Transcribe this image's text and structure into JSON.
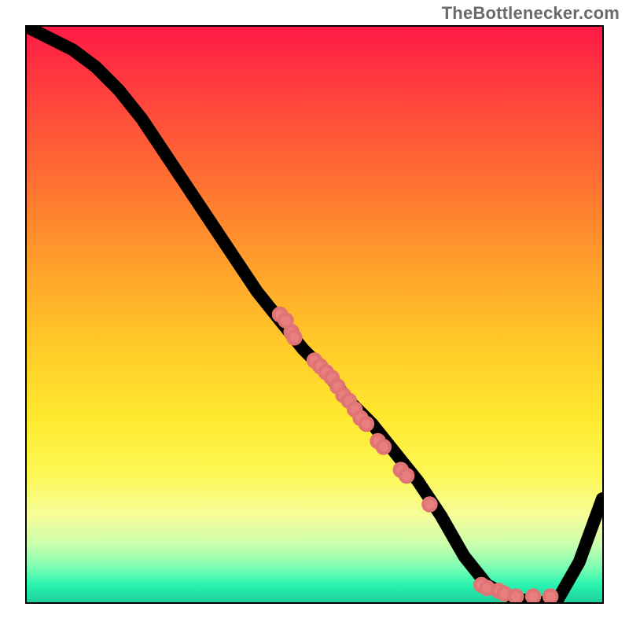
{
  "watermark": "TheBottlenecker.com",
  "colors": {
    "dot_fill": "#e98080",
    "dot_stroke": "#e07474",
    "curve_stroke": "#000000",
    "frame_stroke": "#000000"
  },
  "chart_data": {
    "type": "line",
    "title": "",
    "xlabel": "",
    "ylabel": "",
    "xlim": [
      0,
      100
    ],
    "ylim": [
      0,
      100
    ],
    "grid": false,
    "series": [
      {
        "name": "bottleneck-curve",
        "x": [
          0,
          4,
          8,
          12,
          16,
          20,
          24,
          28,
          32,
          36,
          40,
          44,
          48,
          52,
          56,
          60,
          64,
          68,
          72,
          76,
          80,
          84,
          88,
          92,
          96,
          100
        ],
        "y": [
          100,
          98,
          96,
          93,
          89,
          84,
          78,
          72,
          66,
          60,
          54,
          49,
          44,
          40,
          35,
          31,
          26,
          21,
          15,
          8,
          3,
          1,
          0,
          0,
          7,
          18
        ]
      }
    ],
    "scatter": {
      "name": "data-points",
      "points": [
        {
          "x": 44,
          "y": 50,
          "r": 1.1
        },
        {
          "x": 45,
          "y": 49,
          "r": 1.1
        },
        {
          "x": 46,
          "y": 47,
          "r": 1.1
        },
        {
          "x": 46.5,
          "y": 46,
          "r": 1.1
        },
        {
          "x": 50,
          "y": 42,
          "r": 1.1
        },
        {
          "x": 51,
          "y": 41,
          "r": 1.1
        },
        {
          "x": 52,
          "y": 40,
          "r": 1.1
        },
        {
          "x": 53,
          "y": 39,
          "r": 1.1
        },
        {
          "x": 54,
          "y": 37.5,
          "r": 1.1
        },
        {
          "x": 55,
          "y": 36,
          "r": 1.1
        },
        {
          "x": 56,
          "y": 35,
          "r": 1.1
        },
        {
          "x": 57,
          "y": 33.5,
          "r": 1.1
        },
        {
          "x": 58,
          "y": 32,
          "r": 1.1
        },
        {
          "x": 59,
          "y": 31,
          "r": 1.1
        },
        {
          "x": 61,
          "y": 28,
          "r": 1.1
        },
        {
          "x": 62,
          "y": 27,
          "r": 1.1
        },
        {
          "x": 65,
          "y": 23,
          "r": 1.1
        },
        {
          "x": 66,
          "y": 22,
          "r": 1.1
        },
        {
          "x": 70,
          "y": 17,
          "r": 1.1
        },
        {
          "x": 79,
          "y": 3,
          "r": 1.1
        },
        {
          "x": 80,
          "y": 2.5,
          "r": 1.1
        },
        {
          "x": 82,
          "y": 2,
          "r": 1.1
        },
        {
          "x": 83,
          "y": 1.5,
          "r": 1.1
        },
        {
          "x": 85,
          "y": 1,
          "r": 1.1
        },
        {
          "x": 88,
          "y": 1,
          "r": 1.1
        },
        {
          "x": 91,
          "y": 1,
          "r": 1.1
        }
      ]
    }
  }
}
